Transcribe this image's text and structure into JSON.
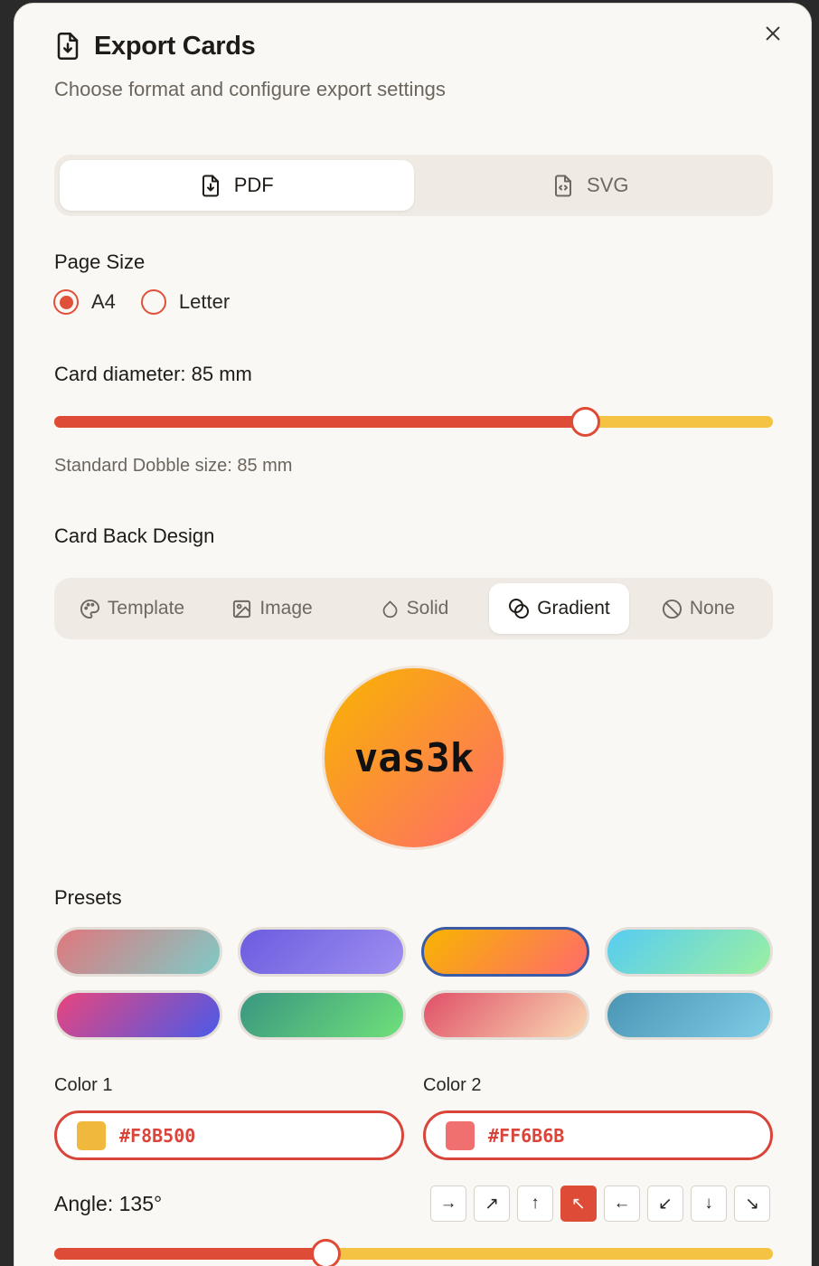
{
  "dialog": {
    "title": "Export Cards",
    "subtitle": "Choose format and configure export settings"
  },
  "format_tabs": [
    {
      "label": "PDF",
      "active": true,
      "icon": "file-download-icon"
    },
    {
      "label": "SVG",
      "active": false,
      "icon": "file-code-icon"
    }
  ],
  "page_size": {
    "label": "Page Size",
    "options": [
      {
        "label": "A4",
        "selected": true
      },
      {
        "label": "Letter",
        "selected": false
      }
    ]
  },
  "card_diameter": {
    "label": "Card diameter: 85 mm",
    "value_fraction": 0.74,
    "hint": "Standard Dobble size: 85 mm"
  },
  "card_back": {
    "label": "Card Back Design",
    "tabs": [
      {
        "label": "Template",
        "icon": "palette-icon",
        "active": false
      },
      {
        "label": "Image",
        "icon": "image-icon",
        "active": false
      },
      {
        "label": "Solid",
        "icon": "droplet-icon",
        "active": false
      },
      {
        "label": "Gradient",
        "icon": "blend-icon",
        "active": true
      },
      {
        "label": "None",
        "icon": "ban-icon",
        "active": false
      }
    ],
    "preview_text": "vas3k"
  },
  "presets": {
    "label": "Presets",
    "items": [
      {
        "from": "#E0777D",
        "to": "#7ECBC6",
        "selected": false
      },
      {
        "from": "#6C5CE0",
        "to": "#9D8FF0",
        "selected": false
      },
      {
        "from": "#F8B500",
        "to": "#FF6B6B",
        "selected": true
      },
      {
        "from": "#56CCF2",
        "to": "#9BF0A0",
        "selected": false
      },
      {
        "from": "#E8457E",
        "to": "#4A5AE8",
        "selected": false
      },
      {
        "from": "#3A9680",
        "to": "#6EE07A",
        "selected": false
      },
      {
        "from": "#E05068",
        "to": "#F9D9B3",
        "selected": false
      },
      {
        "from": "#4A95B4",
        "to": "#7ECCE6",
        "selected": false
      }
    ]
  },
  "color1": {
    "label": "Color 1",
    "value": "#F8B500",
    "swatch": "#F0B83C"
  },
  "color2": {
    "label": "Color 2",
    "value": "#FF6B6B",
    "swatch": "#F07070"
  },
  "angle": {
    "label": "Angle: 135°",
    "value_fraction": 0.375,
    "directions": [
      {
        "glyph": "→",
        "icon": "arrow-right-icon",
        "active": false
      },
      {
        "glyph": "↗",
        "icon": "arrow-up-right-icon",
        "active": false
      },
      {
        "glyph": "↑",
        "icon": "arrow-up-icon",
        "active": false
      },
      {
        "glyph": "↖",
        "icon": "arrow-up-left-icon",
        "active": true
      },
      {
        "glyph": "←",
        "icon": "arrow-left-icon",
        "active": false
      },
      {
        "glyph": "↙",
        "icon": "arrow-down-left-icon",
        "active": false
      },
      {
        "glyph": "↓",
        "icon": "arrow-down-icon",
        "active": false
      },
      {
        "glyph": "↘",
        "icon": "arrow-down-right-icon",
        "active": false
      }
    ]
  },
  "colors": {
    "accent": "#DE4B37",
    "track": "#F5C344",
    "background": "#FAF8F4"
  }
}
